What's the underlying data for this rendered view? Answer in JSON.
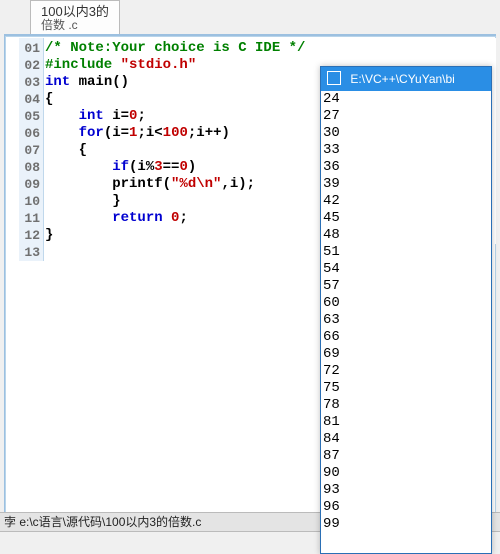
{
  "tab": {
    "line1": "100以内3的",
    "line2": "倍数 .c"
  },
  "code": {
    "lines": [
      {
        "n": "01",
        "tokens": [
          {
            "c": "cmt",
            "t": "/* Note:Your choice is C IDE */"
          }
        ]
      },
      {
        "n": "02",
        "tokens": [
          {
            "c": "pre",
            "t": "#include "
          },
          {
            "c": "str",
            "t": "\"stdio.h\""
          }
        ]
      },
      {
        "n": "03",
        "tokens": [
          {
            "c": "kw",
            "t": "int"
          },
          {
            "c": "txt",
            "t": " main()"
          }
        ]
      },
      {
        "n": "04",
        "tokens": [
          {
            "c": "txt",
            "t": "{"
          }
        ]
      },
      {
        "n": "05",
        "tokens": [
          {
            "c": "txt",
            "t": "    "
          },
          {
            "c": "kw",
            "t": "int"
          },
          {
            "c": "txt",
            "t": " i="
          },
          {
            "c": "num",
            "t": "0"
          },
          {
            "c": "txt",
            "t": ";"
          }
        ]
      },
      {
        "n": "06",
        "tokens": [
          {
            "c": "txt",
            "t": "    "
          },
          {
            "c": "kw",
            "t": "for"
          },
          {
            "c": "txt",
            "t": "(i="
          },
          {
            "c": "num",
            "t": "1"
          },
          {
            "c": "txt",
            "t": ";i<"
          },
          {
            "c": "num",
            "t": "100"
          },
          {
            "c": "txt",
            "t": ";i++)"
          }
        ]
      },
      {
        "n": "07",
        "tokens": [
          {
            "c": "txt",
            "t": "    {"
          }
        ]
      },
      {
        "n": "08",
        "tokens": [
          {
            "c": "txt",
            "t": "        "
          },
          {
            "c": "kw",
            "t": "if"
          },
          {
            "c": "txt",
            "t": "(i%"
          },
          {
            "c": "num",
            "t": "3"
          },
          {
            "c": "txt",
            "t": "=="
          },
          {
            "c": "num",
            "t": "0"
          },
          {
            "c": "txt",
            "t": ")"
          }
        ]
      },
      {
        "n": "09",
        "tokens": [
          {
            "c": "txt",
            "t": ""
          }
        ]
      },
      {
        "n": "10",
        "tokens": [
          {
            "c": "txt",
            "t": "        printf("
          },
          {
            "c": "str",
            "t": "\"%d\\n\""
          },
          {
            "c": "txt",
            "t": ",i);"
          }
        ]
      },
      {
        "n": "11",
        "tokens": [
          {
            "c": "txt",
            "t": "        }"
          }
        ]
      },
      {
        "n": "12",
        "tokens": [
          {
            "c": "txt",
            "t": "        "
          },
          {
            "c": "kw",
            "t": "return"
          },
          {
            "c": "txt",
            "t": " "
          },
          {
            "c": "num",
            "t": "0"
          },
          {
            "c": "txt",
            "t": ";"
          }
        ]
      },
      {
        "n": "13",
        "tokens": [
          {
            "c": "txt",
            "t": "}"
          }
        ]
      }
    ]
  },
  "status": {
    "text": "孛 e:\\c语言\\源代码\\100以内3的倍数.c"
  },
  "console": {
    "title": "E:\\VC++\\CYuYan\\bi",
    "output": [
      "24",
      "27",
      "30",
      "33",
      "36",
      "39",
      "42",
      "45",
      "48",
      "51",
      "54",
      "57",
      "60",
      "63",
      "66",
      "69",
      "72",
      "75",
      "78",
      "81",
      "84",
      "87",
      "90",
      "93",
      "96",
      "99"
    ]
  }
}
